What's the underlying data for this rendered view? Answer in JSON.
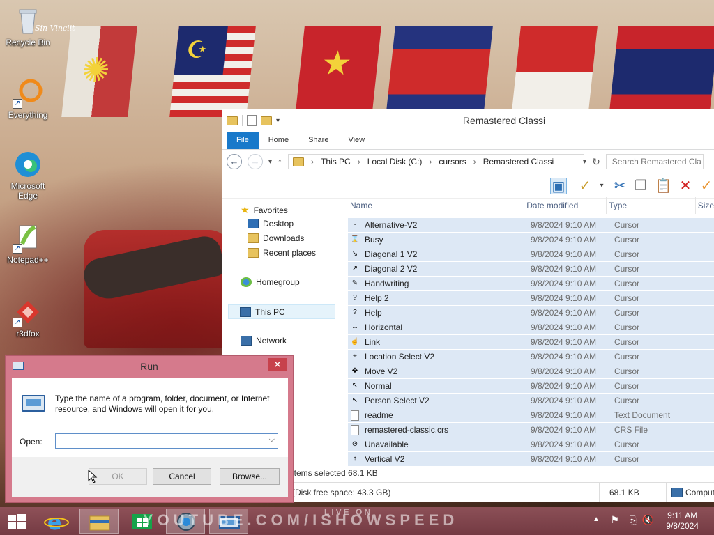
{
  "desktop": {
    "icons": [
      {
        "label": "Recycle Bin",
        "icon": "recycle-bin-icon"
      },
      {
        "label": "Everything",
        "icon": "everything-icon"
      },
      {
        "label": "Microsoft Edge",
        "icon": "edge-icon"
      },
      {
        "label": "Notepad++",
        "icon": "notepadpp-icon"
      },
      {
        "label": "r3dfox",
        "icon": "r3dfox-icon"
      }
    ],
    "wallpaper_signature": "Sin Vinciit"
  },
  "explorer": {
    "title": "Remastered Classi",
    "ribbon_tabs": [
      "File",
      "Home",
      "Share",
      "View"
    ],
    "breadcrumb": [
      "This PC",
      "Local Disk (C:)",
      "cursors",
      "Remastered Classi"
    ],
    "search_placeholder": "Search Remastered Cla",
    "nav": {
      "favorites": "Favorites",
      "desktop": "Desktop",
      "downloads": "Downloads",
      "recent": "Recent places",
      "homegroup": "Homegroup",
      "this_pc": "This PC",
      "network": "Network"
    },
    "columns": {
      "name": "Name",
      "date": "Date modified",
      "type": "Type",
      "size": "Size"
    },
    "files": [
      {
        "name": "Alternative-V2",
        "date": "9/8/2024 9:10 AM",
        "type": "Cursor",
        "glyph": "·"
      },
      {
        "name": "Busy",
        "date": "9/8/2024 9:10 AM",
        "type": "Cursor",
        "glyph": "⌛"
      },
      {
        "name": "Diagonal 1 V2",
        "date": "9/8/2024 9:10 AM",
        "type": "Cursor",
        "glyph": "↘"
      },
      {
        "name": "Diagonal 2 V2",
        "date": "9/8/2024 9:10 AM",
        "type": "Cursor",
        "glyph": "↗"
      },
      {
        "name": "Handwriting",
        "date": "9/8/2024 9:10 AM",
        "type": "Cursor",
        "glyph": "✎"
      },
      {
        "name": "Help 2",
        "date": "9/8/2024 9:10 AM",
        "type": "Cursor",
        "glyph": "?"
      },
      {
        "name": "Help",
        "date": "9/8/2024 9:10 AM",
        "type": "Cursor",
        "glyph": "?"
      },
      {
        "name": "Horizontal",
        "date": "9/8/2024 9:10 AM",
        "type": "Cursor",
        "glyph": "↔"
      },
      {
        "name": "Link",
        "date": "9/8/2024 9:10 AM",
        "type": "Cursor",
        "glyph": "☝"
      },
      {
        "name": "Location Select V2",
        "date": "9/8/2024 9:10 AM",
        "type": "Cursor",
        "glyph": "⌖"
      },
      {
        "name": "Move V2",
        "date": "9/8/2024 9:10 AM",
        "type": "Cursor",
        "glyph": "✥"
      },
      {
        "name": "Normal",
        "date": "9/8/2024 9:10 AM",
        "type": "Cursor",
        "glyph": "↖"
      },
      {
        "name": "Person Select V2",
        "date": "9/8/2024 9:10 AM",
        "type": "Cursor",
        "glyph": "↖"
      },
      {
        "name": "readme",
        "date": "9/8/2024 9:10 AM",
        "type": "Text Document",
        "glyph": "txt"
      },
      {
        "name": "remastered-classic.crs",
        "date": "9/8/2024 9:10 AM",
        "type": "CRS File",
        "glyph": "txt"
      },
      {
        "name": "Unavailable",
        "date": "9/8/2024 9:10 AM",
        "type": "Cursor",
        "glyph": "⊘"
      },
      {
        "name": "Vertical V2",
        "date": "9/8/2024 9:10 AM",
        "type": "Cursor",
        "glyph": "↕"
      }
    ],
    "status_selected": "items selected  68.1 KB",
    "detail_free": "(Disk free space: 43.3 GB)",
    "detail_size": "68.1 KB",
    "detail_computer": "Comput"
  },
  "run": {
    "title": "Run",
    "close": "✕",
    "description": "Type the name of a program, folder, document, or Internet resource, and Windows will open it for you.",
    "open_label": "Open:",
    "input_value": "",
    "ok": "OK",
    "cancel": "Cancel",
    "browse": "Browse..."
  },
  "taskbar": {
    "watermark": "YOUTUBE.COM/ISHOWSPEED",
    "watermark_live": "LIVE ON",
    "time": "9:11 AM",
    "date": "9/8/2024"
  }
}
